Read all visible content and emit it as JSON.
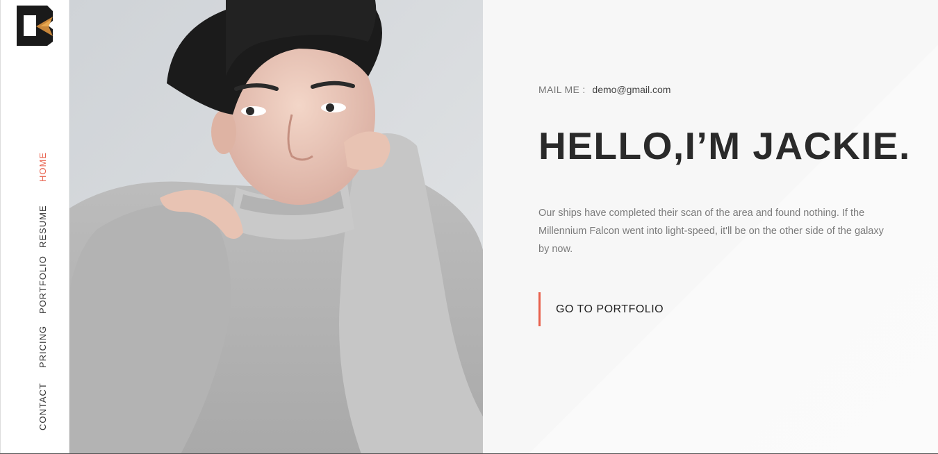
{
  "nav": {
    "items": [
      {
        "label": "HOME",
        "active": true
      },
      {
        "label": "RESUME",
        "active": false
      },
      {
        "label": "PORTFOLIO",
        "active": false
      },
      {
        "label": "PRICING",
        "active": false
      },
      {
        "label": "CONTACT",
        "active": false
      }
    ]
  },
  "hero": {
    "mail_label": "MAIL ME :",
    "mail_value": "demo@gmail.com",
    "headline": "HELLO,I’M JACKIE.",
    "description": "Our ships have completed their scan of the area and found nothing. If the Millennium Falcon went into light-speed, it'll be on the other side of the galaxy by now.",
    "cta_label": "GO TO PORTFOLIO"
  },
  "colors": {
    "accent": "#e8604c",
    "heading": "#2a2a2a",
    "body_text": "#7a7a7a"
  },
  "icons": {
    "logo": "b-logo-icon"
  }
}
